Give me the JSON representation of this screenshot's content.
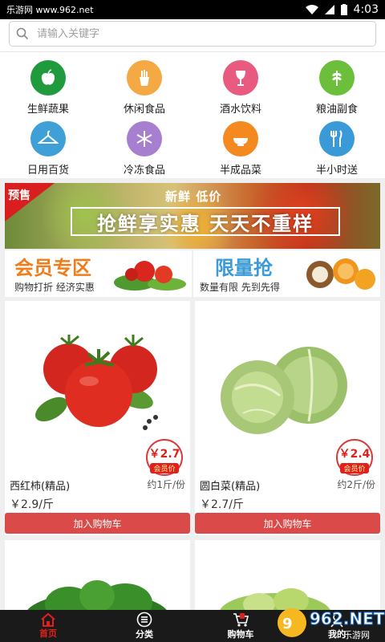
{
  "status_bar": {
    "source_label": "乐游网 www.962.net",
    "time": "4:03"
  },
  "search": {
    "placeholder": "请输入关键字"
  },
  "categories": [
    {
      "label": "生鲜蔬果",
      "icon": "apple-icon",
      "color": "#1f9a3c"
    },
    {
      "label": "休闲食品",
      "icon": "fries-icon",
      "color": "#f5a944"
    },
    {
      "label": "酒水饮料",
      "icon": "wine-glass-icon",
      "color": "#e85a80"
    },
    {
      "label": "粮油副食",
      "icon": "wheat-icon",
      "color": "#6bbf3a"
    },
    {
      "label": "日用百货",
      "icon": "hanger-icon",
      "color": "#3fa0d8"
    },
    {
      "label": "冷冻食品",
      "icon": "snowflake-icon",
      "color": "#a77fd0"
    },
    {
      "label": "半成品菜",
      "icon": "bowl-icon",
      "color": "#f4891f"
    },
    {
      "label": "半小时送",
      "icon": "cutlery-icon",
      "color": "#3a9ad8"
    }
  ],
  "banner": {
    "presale_label": "预售",
    "tagline": "新鲜  低价",
    "headline": "抢鲜享实惠  天天不重样"
  },
  "promos": [
    {
      "title": "会员专区",
      "subtitle": "购物打折  经济实惠",
      "title_color": "#f07d1a"
    },
    {
      "title": "限量抢",
      "subtitle": "数量有限  先到先得",
      "title_color": "#3b9ad8"
    }
  ],
  "products": [
    {
      "name": "西红柿(精品)",
      "unit": "约1斤/份",
      "price": "￥2.9/斤",
      "member_price": "￥2.7",
      "member_label": "会员价",
      "button": "加入购物车"
    },
    {
      "name": "圆白菜(精品)",
      "unit": "约2斤/份",
      "price": "￥2.7/斤",
      "member_price": "￥2.4",
      "member_label": "会员价",
      "button": "加入购物车"
    }
  ],
  "tabs": [
    {
      "label": "首页",
      "icon": "home-icon",
      "active": true
    },
    {
      "label": "分类",
      "icon": "list-icon",
      "active": false
    },
    {
      "label": "购物车",
      "icon": "cart-icon",
      "active": false
    },
    {
      "label": "我的",
      "icon": "user-icon",
      "active": false
    }
  ],
  "watermark": {
    "text": "乐游网"
  },
  "colors": {
    "accent": "#e0201c",
    "button": "#d94a48"
  }
}
